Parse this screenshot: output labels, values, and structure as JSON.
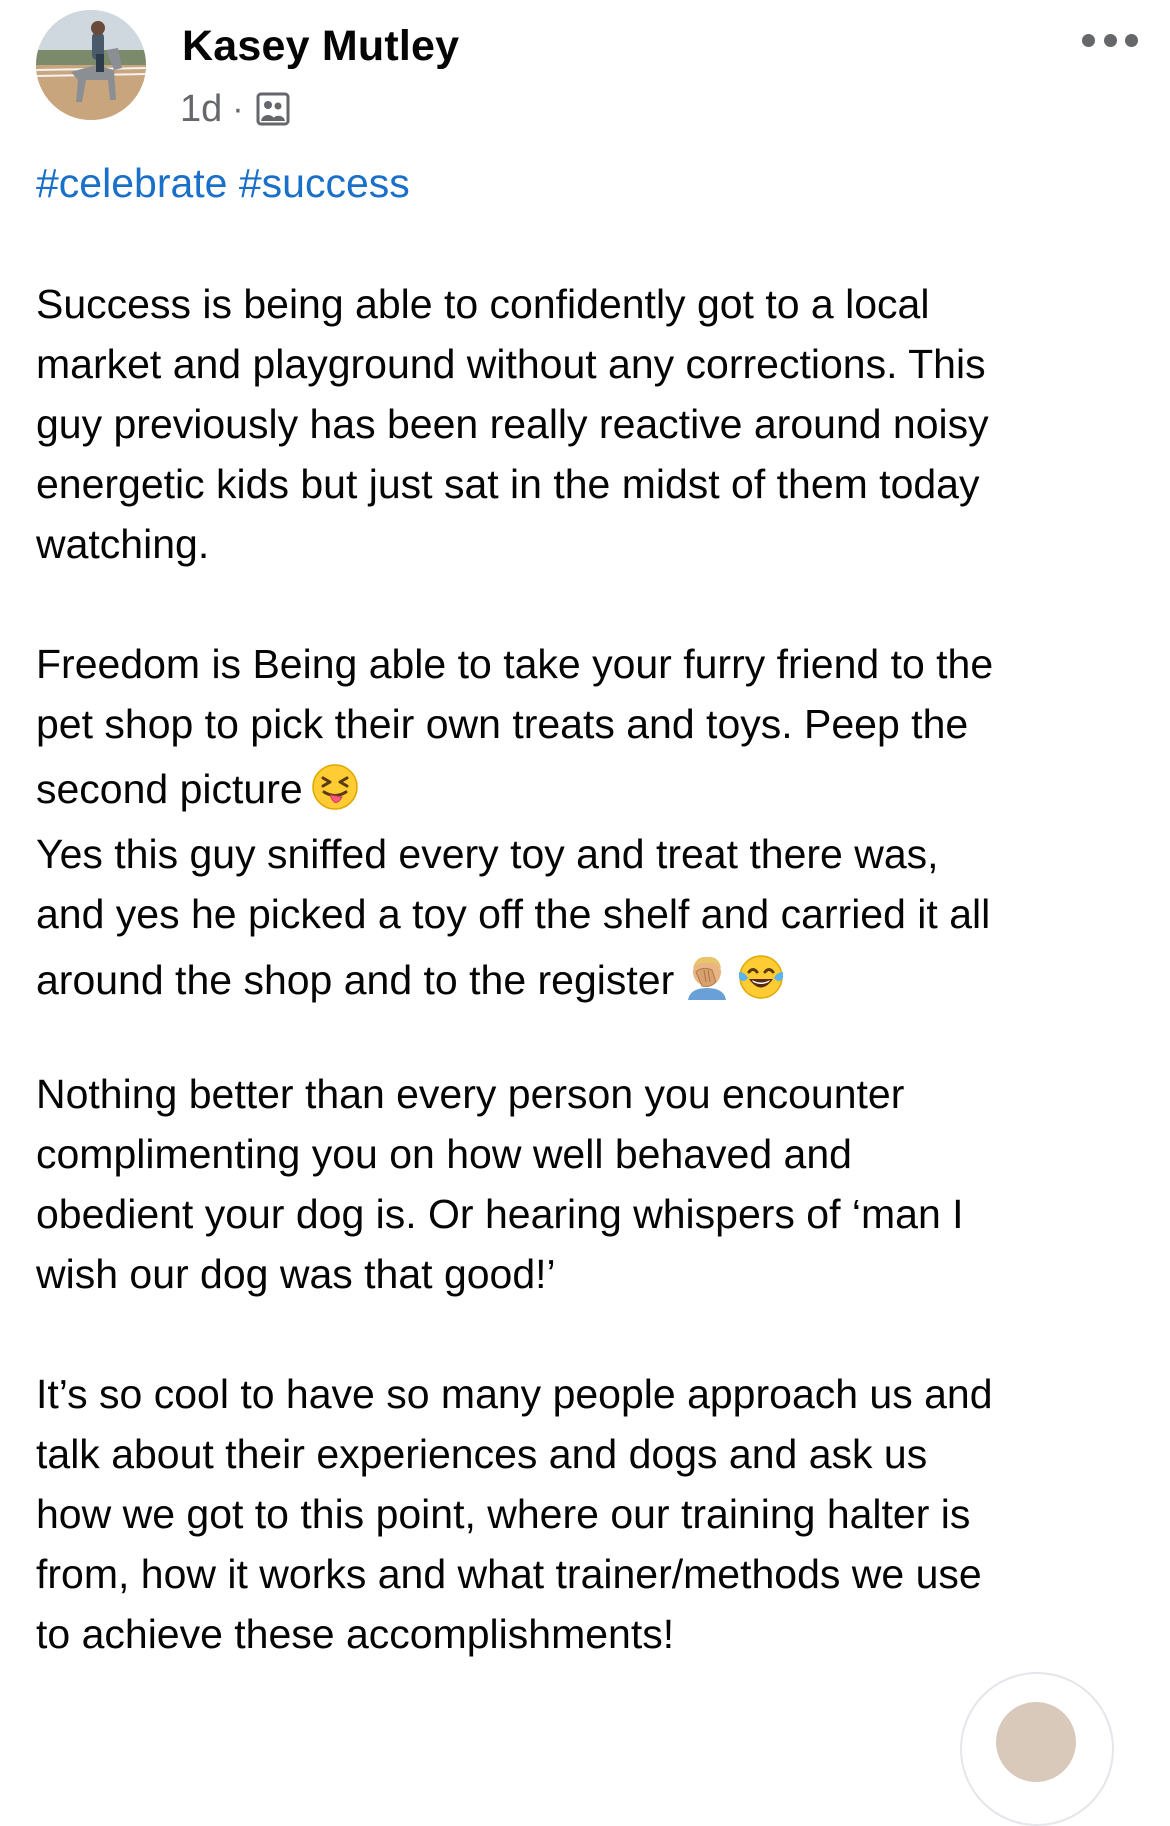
{
  "post": {
    "author_name": "Kasey Mutley",
    "timestamp": "1d",
    "separator": "·",
    "audience_icon": "group-members-icon",
    "more_icon": "more-options-icon",
    "hashtags": [
      "#celebrate",
      "#success"
    ],
    "paragraphs": [
      {
        "lines": [
          "Success is being able to confidently got to a local",
          "market and playground without any corrections. This",
          "guy previously has been really reactive around noisy",
          "energetic kids but just sat in the midst of them today",
          "watching."
        ]
      },
      {
        "lines": [
          "Freedom is Being able to take your furry friend to the",
          "pet shop to pick their own treats and toys. Peep the",
          "second picture",
          "Yes this guy sniffed every toy and treat there was,",
          "and yes he picked a toy off the shelf and carried it all",
          "around the shop and to the register"
        ]
      },
      {
        "lines": [
          "Nothing better than every person you encounter",
          "complimenting you on how well behaved and",
          "obedient your dog is. Or hearing whispers of ‘man I",
          "wish our dog was that good!’"
        ]
      },
      {
        "lines": [
          "It’s so cool to have so many people approach us and",
          "talk about their experiences and dogs and ask us",
          "how we got to this point, where our training halter is",
          "from, how it works and what trainer/methods we use",
          "to achieve these accomplishments!"
        ]
      }
    ],
    "emojis": {
      "after_second_picture": "squinting-face-with-tongue",
      "after_register": [
        "face-palm",
        "face-with-tears-of-joy"
      ]
    }
  },
  "colors": {
    "text": "#050505",
    "secondary_text": "#65676b",
    "hashtag": "#1a6fc9"
  }
}
